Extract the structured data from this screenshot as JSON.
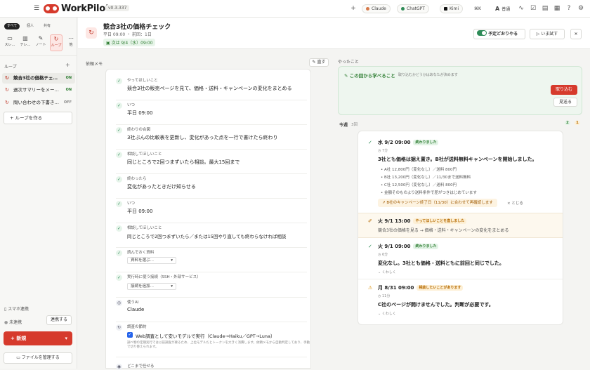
{
  "app": {
    "name": "WorkPilot",
    "version": "v0.3.337"
  },
  "topbar": {
    "models": [
      "Claude",
      "ChatGPT",
      "Kimi"
    ],
    "shortcut": "⌘K",
    "font_mode": "普通"
  },
  "sidebar": {
    "filters": [
      "すべて",
      "個人",
      "共有"
    ],
    "nav": [
      {
        "label": "スレ…",
        "icon": "chat-icon"
      },
      {
        "label": "テレ…",
        "icon": "doc-icon"
      },
      {
        "label": "ノート",
        "icon": "note-icon"
      },
      {
        "label": "ループ",
        "icon": "loop-icon"
      },
      {
        "label": "他",
        "icon": "more-icon"
      }
    ],
    "loops_title": "ループ",
    "loops": [
      {
        "name": "競合3社の価格チェ…",
        "status": "ON"
      },
      {
        "name": "週次サマリーをメー…",
        "status": "ON"
      },
      {
        "name": "問い合わせの下書き…",
        "status": "OFF"
      }
    ],
    "create_loop": "ループを作る",
    "phone_title": "スマホ連携",
    "phone_status": "未連携",
    "phone_button": "連携する",
    "new_button": "新規",
    "files_button": "ファイルを管理する"
  },
  "header": {
    "title": "競合3社の価格チェック",
    "schedule": "平日 09:00 ・ 前回：1日",
    "next_run": "次は 9/4（水）09:00",
    "toggle_label": "予定どおりやる",
    "run_now": "いま試す"
  },
  "memo": {
    "title": "依頼メモ",
    "edit": "直す",
    "rows": [
      {
        "label": "やってほしいこと",
        "value": "競合3社の販売ページを見て、価格・送料・キャンペーンの変化をまとめる"
      },
      {
        "label": "いつ",
        "value": "平日 09:00"
      },
      {
        "label": "終わりの合図",
        "value": "3社ぶんの比較表を更新し、変化があった点を一行で書けたら終わり"
      },
      {
        "label": "相談してほしいこと",
        "value": "同じところで2回つまずいたら相談。最大15回まで"
      },
      {
        "label": "終わったら",
        "value": "変化があったときだけ知らせる"
      },
      {
        "label": "いつ",
        "value": "平日 09:00"
      },
      {
        "label": "相談してほしいこと",
        "value": "同じところで2回つまずいたら／または15回やり直しても終わらなければ相談"
      },
      {
        "label": "読んでおく資料",
        "value": "資料を選ぶ…"
      },
      {
        "label": "実行時に使う接続（SSH・外部サービス）",
        "value": "接続を追加…"
      },
      {
        "label": "使うAI",
        "value": "Claude"
      },
      {
        "label": "調査の節約",
        "value": "Web調査として安いモデルで実行（Claude→Haiku／GPT→Luna）"
      }
    ],
    "note": "調べ物の定期実行では以前調査が要るため、上位モデルだとトークンを大きく消費します。依頼メモから自動判定しており、手動で切り替えられます。",
    "last_label": "どこまで任せる"
  },
  "done": {
    "title": "やったこと",
    "learn_title": "この回から学べること",
    "learn_hint": "取り込むかどうかはあなたが決めます",
    "adopt": "取り込む",
    "skip": "見送る",
    "week_label": "今週",
    "week_count": "3回",
    "count_a": "2",
    "count_b": "1",
    "entries": [
      {
        "date": "水 9/2 09:00",
        "badge": "終わりました",
        "time": "7分",
        "text": "3社とも価格は据え置き。B社が送料無料キャンペーンを開始しました。",
        "bullets": [
          "A社 12,800円（変化なし）／送料 800円",
          "B社 13,200円（変化なし）／11/30まで送料無料",
          "C社 12,500円（変化なし）／送料 800円",
          "金額そのものより送料条件で差がつきはじめています"
        ],
        "suggest": "B社のキャンペーン終了日（11/30）に合わせて再確認します",
        "suggest_action": "とじる"
      },
      {
        "date": "火 9/1 13:00",
        "badge": "やってほしいことを直しました",
        "text": "競合3社の価格を見る → 価格・送料・キャンペーンの変化をまとめる"
      },
      {
        "date": "火 9/1 09:00",
        "badge": "終わりました",
        "time": "6分",
        "text": "変化なし。3社とも価格・送料ともに前回と同じでした。",
        "more": "くわしく"
      },
      {
        "date": "月 8/31 09:00",
        "badge": "相談したいことがあります",
        "time": "11分",
        "text": "C社のページが開けませんでした。判断が必要です。",
        "more": "くわしく"
      }
    ]
  }
}
